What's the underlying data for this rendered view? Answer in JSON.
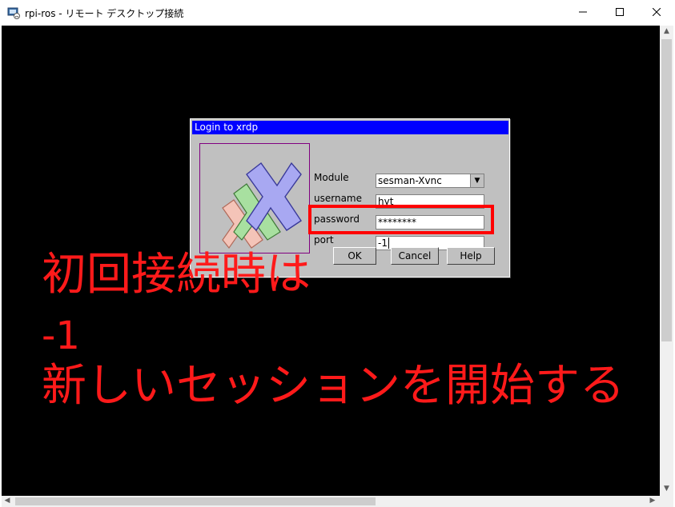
{
  "window": {
    "title": "rpi-ros - リモート デスクトップ接続",
    "minimize_icon": "minimize-icon",
    "maximize_icon": "maximize-icon",
    "close_icon": "close-icon"
  },
  "dialog": {
    "title": "Login to xrdp",
    "labels": {
      "module": "Module",
      "username": "username",
      "password": "password",
      "port": "port"
    },
    "fields": {
      "module": "sesman-Xvnc",
      "username": "hyt",
      "password": "********",
      "port": "-1"
    },
    "buttons": {
      "ok": "OK",
      "cancel": "Cancel",
      "help": "Help"
    },
    "logo_icon": "xrdp-logo-icon"
  },
  "annotation": {
    "line1": "初回接続時は",
    "line2": "-1",
    "line3": "新しいセッションを開始する",
    "color": "#ff1a1a"
  }
}
